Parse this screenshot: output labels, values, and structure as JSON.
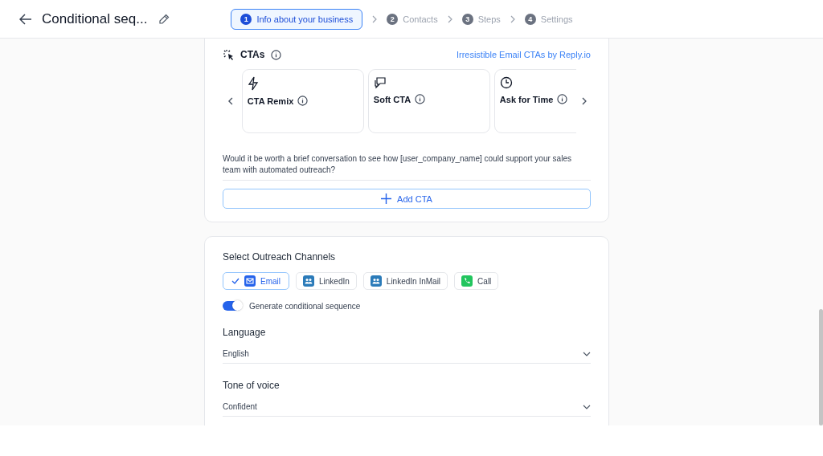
{
  "header": {
    "title": "Conditional seq...",
    "steps": [
      {
        "number": "1",
        "label": "Info about your business",
        "selected": true
      },
      {
        "number": "2",
        "label": "Contacts",
        "selected": false
      },
      {
        "number": "3",
        "label": "Steps",
        "selected": false
      },
      {
        "number": "4",
        "label": "Settings",
        "selected": false
      }
    ]
  },
  "ctas": {
    "title": "CTAs",
    "link": "Irresistible Email CTAs by Reply.io",
    "cards": [
      {
        "kind": "bolt",
        "label": "CTA Remix"
      },
      {
        "kind": "chat",
        "label": "Soft CTA"
      },
      {
        "kind": "clock",
        "label": "Ask for Time"
      }
    ],
    "text": "Would it be worth a brief conversation to see how [user_company_name] could support your sales team with automated outreach?",
    "add_button": "Add CTA"
  },
  "outreach": {
    "title": "Select Outreach Channels",
    "channels": [
      {
        "kind": "email",
        "label": "Email",
        "selected": true
      },
      {
        "kind": "linkedin",
        "label": "LinkedIn",
        "selected": false
      },
      {
        "kind": "linkedin",
        "label": "LinkedIn InMail",
        "selected": false
      },
      {
        "kind": "call",
        "label": "Call",
        "selected": false
      }
    ],
    "toggle": {
      "label": "Generate conditional sequence",
      "on": true
    },
    "selects": [
      {
        "label": "Language",
        "value": "English"
      },
      {
        "label": "Tone of voice",
        "value": "Confident"
      }
    ]
  }
}
